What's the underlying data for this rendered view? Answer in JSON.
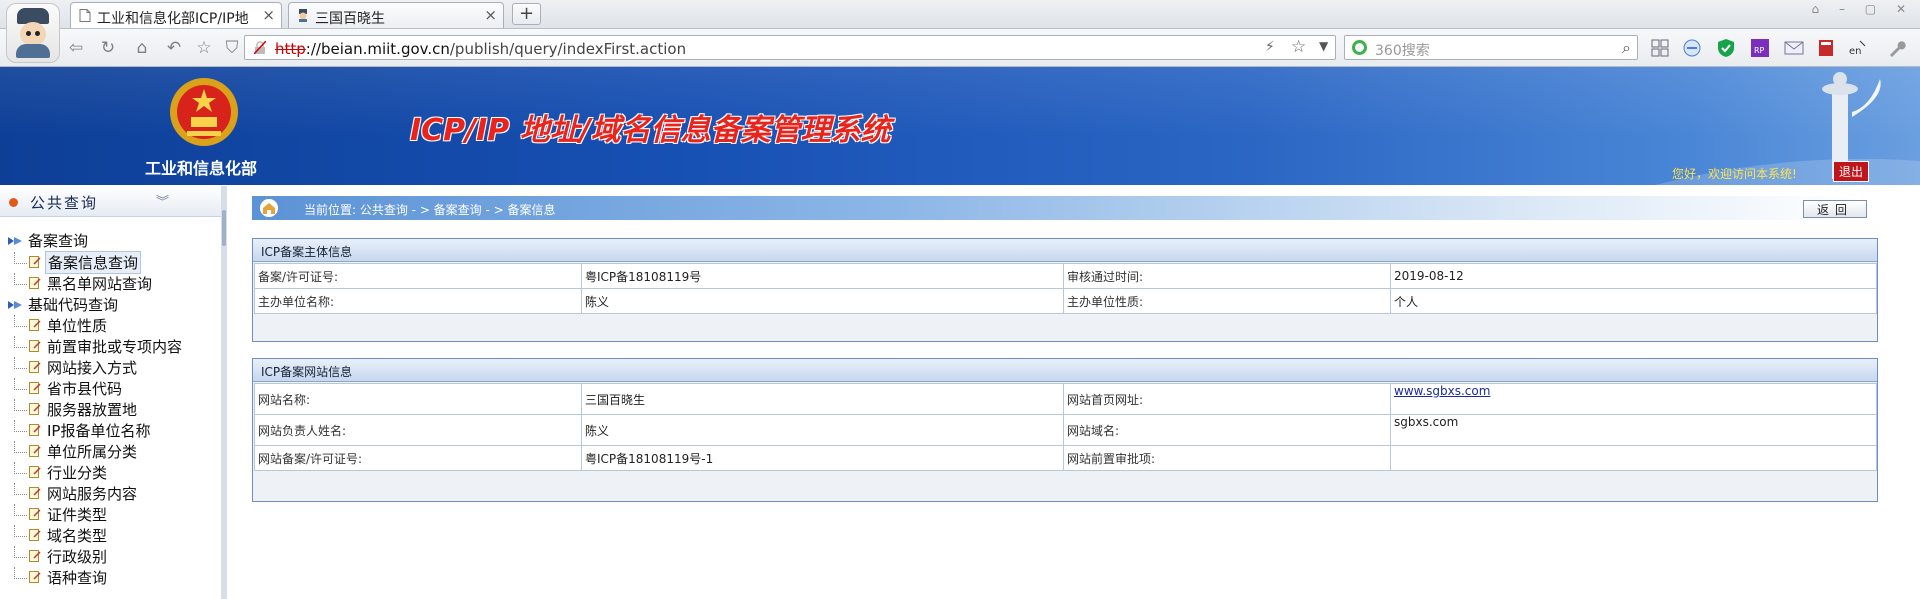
{
  "browser": {
    "tabs": [
      {
        "label": "工业和信息化部ICP/IP地",
        "close": "×",
        "icon": "page-icon",
        "active": true
      },
      {
        "label": "三国百晓生",
        "close": "×",
        "icon": "site-favicon",
        "active": false
      }
    ],
    "new_tab": "+",
    "url": {
      "protocol": "http",
      "host": "://beian.miit.gov.cn",
      "path": "/publish/query/indexFirst.action"
    },
    "search_placeholder": "360搜索",
    "window_controls": "⌂ – ▢ ✕"
  },
  "header": {
    "ministry_name": "工业和信息化部",
    "system_title": "ICP/IP 地址/域名信息备案管理系统",
    "welcome": "您好，欢迎访问本系统!",
    "logout": "退出"
  },
  "sidebar": {
    "title": "公共查询",
    "groups": [
      {
        "label": "备案查询",
        "items": [
          "备案信息查询",
          "黑名单网站查询"
        ]
      },
      {
        "label": "基础代码查询",
        "items": [
          "单位性质",
          "前置审批或专项内容",
          "网站接入方式",
          "省市县代码",
          "服务器放置地",
          "IP报备单位名称",
          "单位所属分类",
          "行业分类",
          "网站服务内容",
          "证件类型",
          "域名类型",
          "行政级别",
          "语种查询"
        ]
      }
    ],
    "selected": "备案信息查询"
  },
  "breadcrumb": "当前位置: 公共查询  - >  备案查询  - >  备案信息",
  "back_button": "返回",
  "subject_panel": {
    "title": "ICP备案主体信息",
    "rows": [
      [
        "备案/许可证号:",
        "粤ICP备18108119号",
        "审核通过时间:",
        "2019-08-12"
      ],
      [
        "主办单位名称:",
        "陈义",
        "主办单位性质:",
        "个人"
      ]
    ]
  },
  "site_panel": {
    "title": "ICP备案网站信息",
    "rows": [
      [
        "网站名称:",
        "三国百晓生",
        "网站首页网址:",
        "www.sgbxs.com"
      ],
      [
        "网站负责人姓名:",
        "陈义",
        "网站域名:",
        "sgbxs.com"
      ],
      [
        "网站备案/许可证号:",
        "粤ICP备18108119号-1",
        "网站前置审批项:",
        ""
      ]
    ]
  },
  "colors": {
    "header_blue": "#1750b3",
    "title_red": "#e8241c",
    "link": "#1a2a9a",
    "welcome_yellow": "#ffe34d"
  }
}
